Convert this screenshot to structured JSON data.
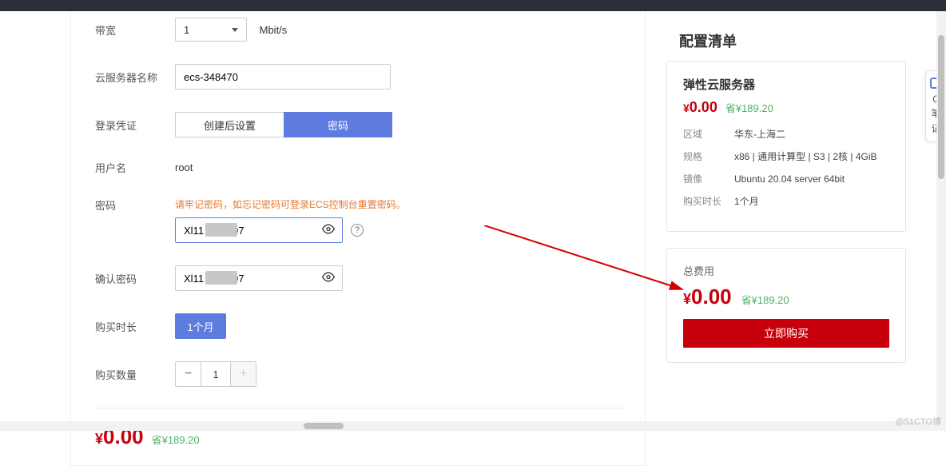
{
  "form": {
    "bandwidth": {
      "label": "带宽",
      "value": "1",
      "unit": "Mbit/s"
    },
    "server_name": {
      "label": "云服务器名称",
      "value": "ecs-348470"
    },
    "credentials": {
      "label": "登录凭证",
      "option_setup": "创建后设置",
      "option_password": "密码"
    },
    "username": {
      "label": "用户名",
      "value": "root"
    },
    "password": {
      "label": "密码",
      "hint": "请牢记密码，如忘记密码可登录ECS控制台重置密码。",
      "value": "Xl11        497"
    },
    "confirm": {
      "label": "确认密码",
      "value": "Xl11        497"
    },
    "duration": {
      "label": "购买时长",
      "value": "1个月"
    },
    "quantity": {
      "label": "购买数量",
      "value": "1"
    }
  },
  "main_price": {
    "amount": "0.00",
    "save": "省¥189.20"
  },
  "sidebar": {
    "title": "配置清单",
    "product": {
      "title": "弹性云服务器",
      "price": "0.00",
      "save": "省¥189.20",
      "specs": {
        "region_label": "区域",
        "region_value": "华东-上海二",
        "spec_label": "规格",
        "spec_value": "x86 | 通用计算型 | S3 | 2核 | 4GiB",
        "image_label": "镜像",
        "image_value": "Ubuntu 20.04 server 64bit",
        "duration_label": "购买时长",
        "duration_value": "1个月"
      }
    },
    "total": {
      "label": "总费用",
      "price": "0.00",
      "save": "省¥189.20",
      "buy": "立即购买"
    }
  },
  "side_tab": {
    "l1": "C",
    "l2": "笔",
    "l3": "记"
  },
  "watermark": "@51CTO博"
}
